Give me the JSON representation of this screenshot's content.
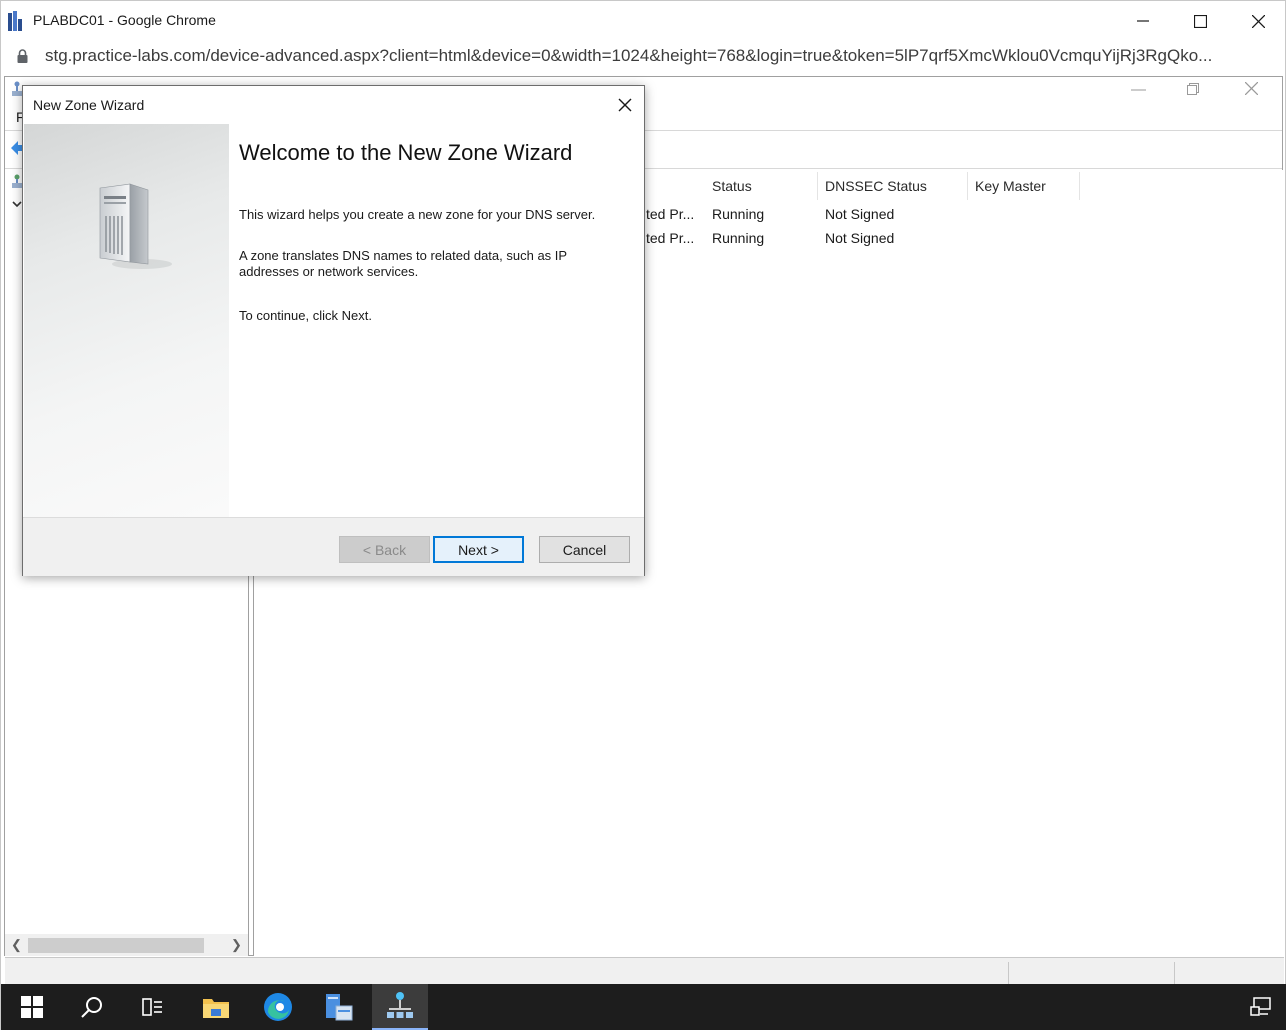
{
  "browser": {
    "window_title": "PLABDC01 - Google Chrome",
    "url": "stg.practice-labs.com/device-advanced.aspx?client=html&device=0&width=1024&height=768&login=true&token=5lP7qrf5XmcWklou0VcmquYijRj3RgQko..."
  },
  "dns_manager": {
    "menu_first_letter": "F",
    "columns": [
      "Status",
      "DNSSEC Status",
      "Key Master"
    ],
    "rows": [
      {
        "type_trunc": "ted Pr...",
        "status": "Running",
        "dnssec": "Not Signed"
      },
      {
        "type_trunc": "ted Pr...",
        "status": "Running",
        "dnssec": "Not Signed"
      }
    ]
  },
  "wizard": {
    "title": "New Zone Wizard",
    "heading": "Welcome to the New Zone Wizard",
    "para1": "This wizard helps you create a new zone for your DNS server.",
    "para2": "A zone translates DNS names to related data, such as IP addresses or network services.",
    "para3": "To continue, click Next.",
    "buttons": {
      "back": "< Back",
      "next": "Next >",
      "cancel": "Cancel"
    }
  },
  "taskbar": {
    "items": [
      "start-icon",
      "search-icon",
      "task-view-icon",
      "file-explorer-icon",
      "edge-icon",
      "server-manager-icon",
      "dns-manager-icon",
      "network-icon"
    ]
  },
  "colors": {
    "accent": "#0078d7",
    "taskbar": "#1d1d1d",
    "edge_blue": "#1e88e5"
  }
}
